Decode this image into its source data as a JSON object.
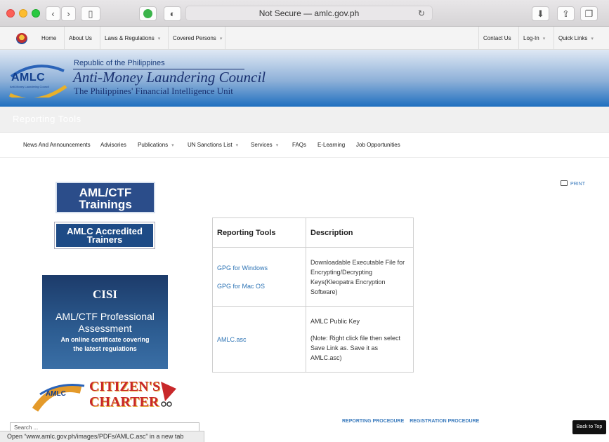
{
  "browser": {
    "address": "Not Secure — amlc.gov.ph"
  },
  "topnav": {
    "items": [
      "Home",
      "About Us",
      "Laws & Regulations",
      "Covered Persons",
      "Contact Us",
      "Log-In",
      "Quick Links"
    ]
  },
  "banner": {
    "logo": "AMLC",
    "logo_sub": "Anti-Money Laundering Council",
    "republic": "Republic of the Philippines",
    "council": "Anti-Money Laundering Council",
    "fiu": "The Philippines' Financial Intelligence Unit"
  },
  "page_title": "Reporting Tools",
  "mainnav": {
    "items": [
      "News And Announcements",
      "Advisories",
      "Publications",
      "UN Sanctions List",
      "Services",
      "FAQs",
      "E-Learning",
      "Job Opportunities"
    ]
  },
  "sidebar": {
    "aml_line1": "AML/CTF",
    "aml_line2": "Trainings",
    "accred_line1": "AMLC Accredited",
    "accred_line2": "Trainers",
    "cisi_logo": "CISI",
    "cisi_line1": "AML/CTF Professional",
    "cisi_line2": "Assessment",
    "cisi_line3": "An online certificate covering",
    "cisi_line4": "the latest regulations",
    "charter_logo": "AMLC",
    "charter_line1": "CITIZEN'S",
    "charter_line2": "CHARTER"
  },
  "print_label": "PRINT",
  "table": {
    "headers": [
      "Reporting Tools",
      "Description"
    ],
    "rows": [
      {
        "links": [
          "GPG for Windows",
          "GPG for Mac OS"
        ],
        "desc": [
          "Downloadable Executable File for Encrypting/Decrypting Keys(Kleopatra Encryption Software)"
        ]
      },
      {
        "links": [
          "AMLC.asc"
        ],
        "desc": [
          "AMLC Public Key",
          "(Note: Right click file then select Save Link as. Save it as AMLC.asc)"
        ]
      }
    ]
  },
  "footer": {
    "link1": "REPORTING PROCEDURE",
    "link2": "REGISTRATION PROCEDURE",
    "back_to_top": "Back to Top",
    "search_placeholder": "Search ..."
  },
  "status": "Open “www.amlc.gov.ph/images/PDFs/AMLC.asc” in a new tab",
  "colors": {
    "link": "#2e74b5",
    "brand_blue": "#1f6fbf"
  }
}
